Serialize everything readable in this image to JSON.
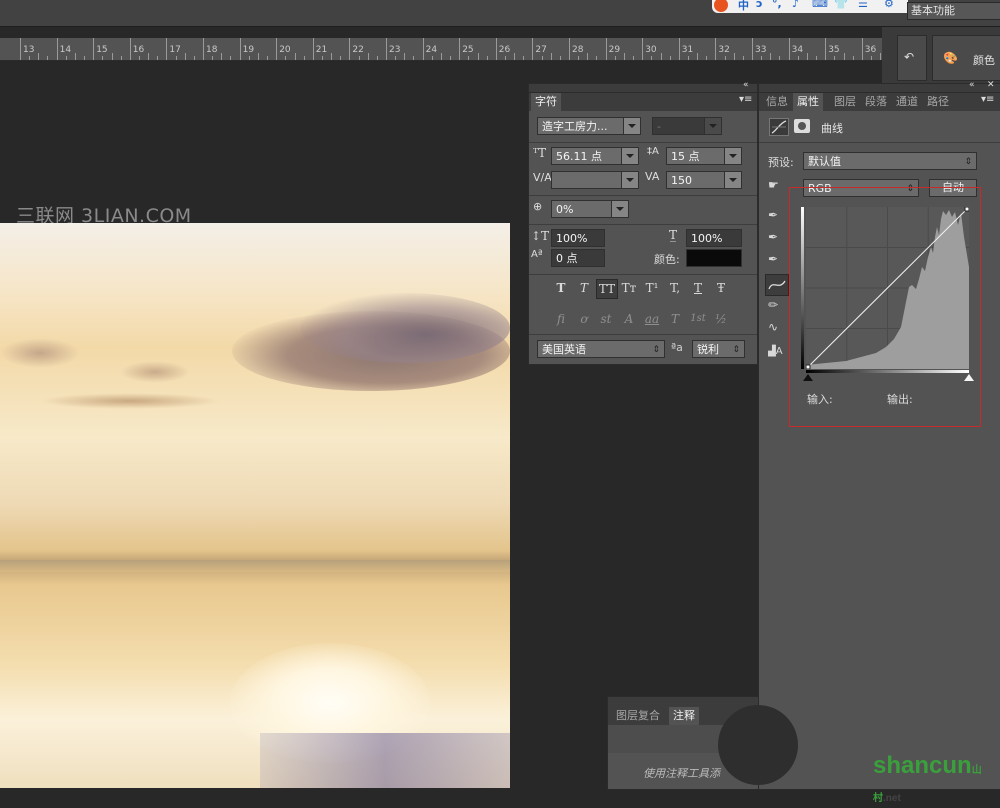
{
  "topbar": {
    "workspace_label": "基本功能",
    "ime_glyphs": [
      "中",
      "ɔ",
      "°,",
      "♪",
      "⌨",
      "👕",
      "☰",
      "⚙"
    ]
  },
  "ruler": {
    "labels": [
      "13",
      "14",
      "15",
      "16",
      "17",
      "18",
      "19",
      "20",
      "21",
      "22",
      "23",
      "24",
      "25",
      "26",
      "27",
      "28",
      "29",
      "30",
      "31",
      "32",
      "33",
      "34",
      "35",
      "36"
    ]
  },
  "canvas": {
    "watermark": "三联网 3LIAN.COM"
  },
  "right_dock": {
    "color_label": "颜色"
  },
  "character_panel": {
    "tab": "字符",
    "font_family": "造字工房力...",
    "font_style": "-",
    "font_size": "56.11 点",
    "leading": "15 点",
    "kerning": "",
    "tracking": "150",
    "tsume": "0%",
    "vertical_scale": "100%",
    "horizontal_scale": "100%",
    "baseline_shift": "0 点",
    "color_label": "颜色:",
    "style_buttons": [
      "T",
      "T",
      "TT",
      "Tт",
      "T¹",
      "T,",
      "T",
      "Ŧ"
    ],
    "opentype_buttons": [
      "fi",
      "ơ",
      "st",
      "A",
      "aa",
      "T",
      "1st",
      "½"
    ],
    "language": "美国英语",
    "aa_icon": "ªa",
    "antialias": "锐利"
  },
  "properties_panel": {
    "tabs": [
      "信息",
      "属性",
      "图层",
      "段落",
      "通道",
      "路径"
    ],
    "active_tab": "属性",
    "adjustment_title": "曲线",
    "preset_label": "预设:",
    "preset_value": "默认值",
    "channel_value": "RGB",
    "auto_button": "自动",
    "input_label": "输入:",
    "output_label": "输出:"
  },
  "notes_panel": {
    "tabs": [
      "图层复合",
      "注释"
    ],
    "active_tab": "注释",
    "hint": "使用注释工具添"
  },
  "branding": {
    "logo_text": "shancun",
    "logo_sub": "山村",
    "logo_net": ".net"
  }
}
